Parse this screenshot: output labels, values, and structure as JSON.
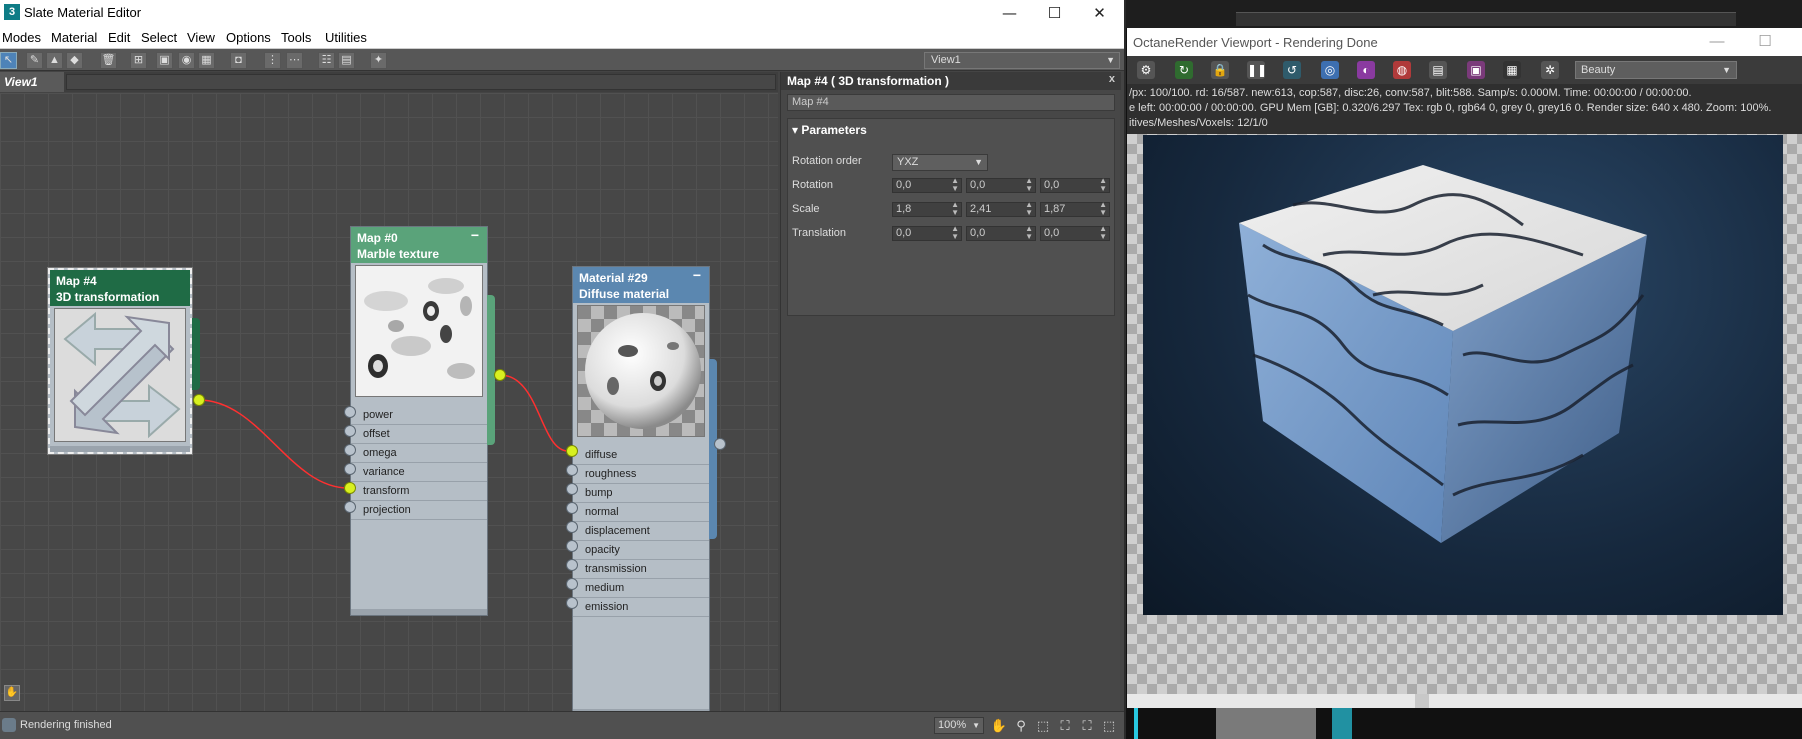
{
  "sme": {
    "title": "Slate Material Editor",
    "window_buttons": {
      "minimize": "—",
      "maximize": "☐",
      "close": "✕"
    },
    "menu": [
      "Modes",
      "Material",
      "Edit",
      "Select",
      "View",
      "Options",
      "Tools",
      "Utilities"
    ],
    "view_select": "View1",
    "view_tab": "View1",
    "nodes": {
      "map4": {
        "line1": "Map #4",
        "line2": "3D transformation",
        "min": "−"
      },
      "map0": {
        "line1": "Map #0",
        "line2": "Marble texture",
        "min": "−",
        "sockets": [
          "power",
          "offset",
          "omega",
          "variance",
          "transform",
          "projection"
        ]
      },
      "mat29": {
        "line1": "Material #29",
        "line2": "Diffuse material",
        "min": "−",
        "sockets": [
          "diffuse",
          "roughness",
          "bump",
          "normal",
          "displacement",
          "opacity",
          "transmission",
          "medium",
          "emission"
        ]
      }
    },
    "params": {
      "title": "Map #4  ( 3D transformation )",
      "close": "x",
      "name_field": "Map #4",
      "group": "Parameters",
      "rotation_order_label": "Rotation order",
      "rotation_order_value": "YXZ",
      "rotation_label": "Rotation",
      "rotation": [
        "0,0",
        "0,0",
        "0,0"
      ],
      "scale_label": "Scale",
      "scale": [
        "1,8",
        "2,41",
        "1,87"
      ],
      "translation_label": "Translation",
      "translation": [
        "0,0",
        "0,0",
        "0,0"
      ]
    },
    "status": {
      "text": "Rendering finished",
      "zoom": "100%"
    }
  },
  "octane": {
    "title": "OctaneRender Viewport - Rendering Done",
    "window_buttons": {
      "minimize": "—",
      "maximize": "☐"
    },
    "pass": "Beauty",
    "info_line1": "/px: 100/100.   rd: 16/587.   new:613, cop:587, disc:26, conv:587, blit:588.   Samp/s: 0.000M.   Time: 00:00:00 / 00:00:00.",
    "info_line2": "e left: 00:00:00 / 00:00:00.   GPU Mem [GB]: 0.320/6.297   Tex: rgb 0, rgb64 0, grey 0, grey16 0.   Render size: 640 x 480.   Zoom: 100%.",
    "info_line3": "itives/Meshes/Voxels: 12/1/0"
  },
  "colors": {
    "wire": "#ff3030",
    "socket_on": "#d8f020",
    "map4_header": "#1f6b45",
    "map0_header": "#5aa37a",
    "mat_header": "#5b87b0"
  }
}
